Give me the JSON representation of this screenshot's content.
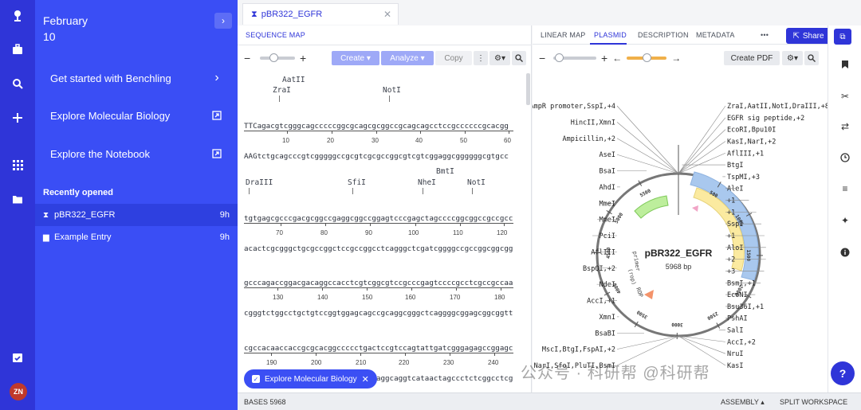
{
  "sidebar": {
    "date_month": "February",
    "date_day": "10",
    "links": [
      {
        "label": "Get started with Benchling",
        "icon": "chevron-right-icon"
      },
      {
        "label": "Explore Molecular Biology",
        "icon": "external-window-icon"
      },
      {
        "label": "Explore the Notebook",
        "icon": "external-window-icon"
      }
    ],
    "recent_heading": "Recently opened",
    "recent": [
      {
        "label": "pBR322_EGFR",
        "time": "9h",
        "icon": "dna-icon"
      },
      {
        "label": "Example Entry",
        "time": "9h",
        "icon": "document-icon"
      }
    ],
    "avatar_initials": "ZN"
  },
  "doc_tab": {
    "label": "pBR322_EGFR"
  },
  "sequence": {
    "tab_label": "SEQUENCE MAP",
    "toolbar": {
      "create": "Create",
      "analyze": "Analyze",
      "copy": "Copy"
    },
    "blocks": [
      {
        "top": "TTCagacgtcgggcagcccccggcgcagcgcggccgcagcagcctccgccccccgcacgg",
        "bottom": "AAGtctgcagcccgtcgggggccgcgtcgcgccggcgtcgtcggaggcggggggcgtgcc",
        "enzymes": [
          "AatII",
          "ZraI",
          "NotI"
        ],
        "ruler": [
          "10",
          "20",
          "30",
          "40",
          "50",
          "60"
        ]
      },
      {
        "top": "tgtgagcgcccgacgcggccgaggcggccggagtcccgagctagccccggcggccgccgcc",
        "bottom": "acactcgcgggctgcgccggctccgccggcctcagggctcgatcggggccgccggcggcgg",
        "enzymes": [
          "DraIII",
          "SfiI",
          "BmtI",
          "NheI",
          "NotI"
        ],
        "ruler": [
          "70",
          "80",
          "90",
          "100",
          "110",
          "120"
        ]
      },
      {
        "top": "gcccagaccggacgacaggccacctcgtcggcgtccgcccgagtccccgcctcgccgccaa",
        "bottom": "cgggtctggcctgctgtccggtggagcagccgcaggcgggctcaggggcggagcggcggtt",
        "enzymes": [],
        "ruler": [
          "130",
          "140",
          "150",
          "160",
          "170",
          "180"
        ]
      },
      {
        "top": "cgccacaaccaccgcgcacggccccctgactccgtccagtattgatcgggagagccggagc",
        "bottom": "gcggtgttggtggcgcgtgccgggggactgaggcaggtcataactagccctctcggcctcg",
        "enzymes": [],
        "ruler": [
          "190",
          "200",
          "210",
          "220",
          "230",
          "240"
        ]
      }
    ],
    "chip_label": "Explore Molecular Biology"
  },
  "map": {
    "tabs": [
      "LINEAR MAP",
      "PLASMID",
      "DESCRIPTION",
      "METADATA",
      "•••"
    ],
    "active_tab": "PLASMID",
    "share_label": "Share",
    "create_pdf": "Create PDF",
    "plasmid_name": "pBR322_EGFR",
    "plasmid_size": "5968 bp",
    "ring_ticks": [
      "500",
      "1000",
      "1500",
      "2000",
      "2500",
      "3000",
      "3500",
      "4000",
      "4500",
      "5000",
      "5500"
    ],
    "feature_labels": [
      "primer",
      "(rop)",
      "ROP"
    ],
    "left_labels": [
      "AmpR promoter,SspI,+4",
      "HincII,XmnI",
      "Ampicillin,+2",
      "AseI",
      "BsaI",
      "AhdI",
      "MmeI",
      "MmeI",
      "PciI",
      "AflIII",
      "BspQI,+2",
      "NdeI",
      "AccI,+1",
      "XmnI",
      "BsaBI",
      "MscI,BtgI,FspAI,+2",
      "NarI,SfoI,PluTI,BsmI"
    ],
    "right_labels": [
      "ZraI,AatII,NotI,DraIII,+8",
      "EGFR sig peptide,+2",
      "EcoRI,Bpu10I",
      "KasI,NarI,+2",
      "AflIII,+1",
      "BtgI",
      "TspMI,+3",
      "AleI",
      "+1",
      "+1",
      "SspI",
      "+1",
      "AloI",
      "+2",
      "+3",
      "BsmI,+1",
      "EcoNI",
      "Bsu36I,+1",
      "PshAI",
      "SalI",
      "AccI,+2",
      "NruI",
      "KasI"
    ]
  },
  "status": {
    "bases": "BASES 5968",
    "assembly": "ASSEMBLY ▴",
    "split": "SPLIT WORKSPACE"
  },
  "help_label": "?",
  "watermark": "公众号 · 科研帮 @科研帮",
  "colors": {
    "rail": "#2f35d8",
    "panel": "#3a4ef5",
    "accent": "#2f35d8"
  }
}
